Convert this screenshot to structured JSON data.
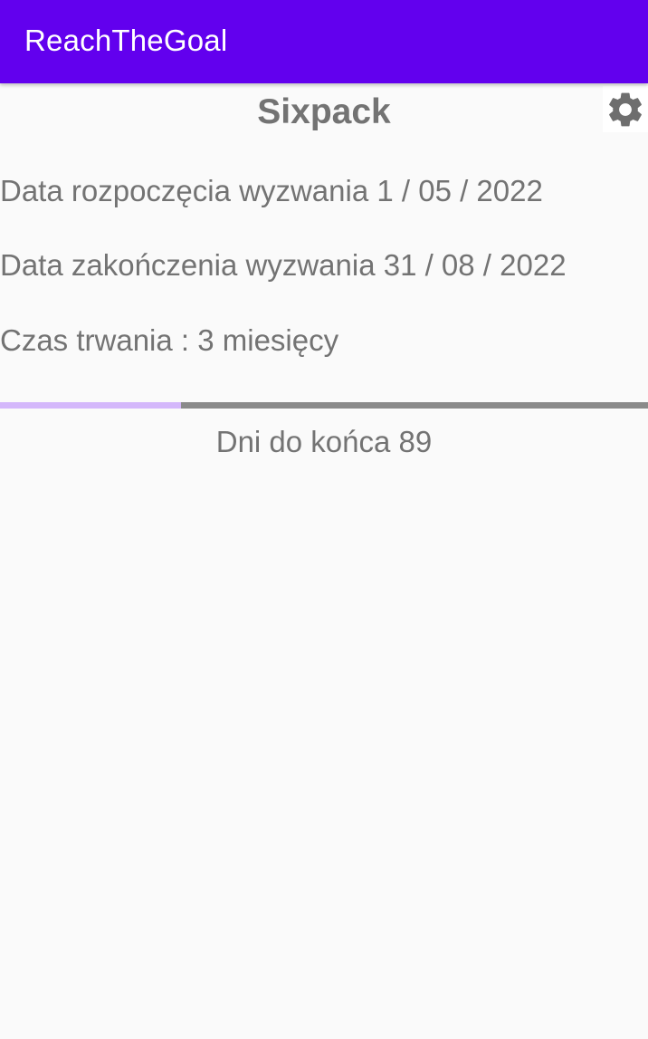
{
  "app_bar": {
    "title": "ReachTheGoal",
    "background_color": "#6200ee"
  },
  "goal": {
    "title": "Sixpack",
    "start_label": "Data rozpoczęcia wyzwania 1 / 05 / 2022",
    "end_label": "Data zakończenia wyzwania 31 / 08 / 2022",
    "duration_label": "Czas trwania : 3 miesięcy",
    "progress_fraction": 0.28,
    "progress_color": "#d4b7fb",
    "track_color": "#8a8a8a",
    "days_left_label": "Dni do końca 89"
  },
  "icons": {
    "settings": "gear-icon"
  }
}
